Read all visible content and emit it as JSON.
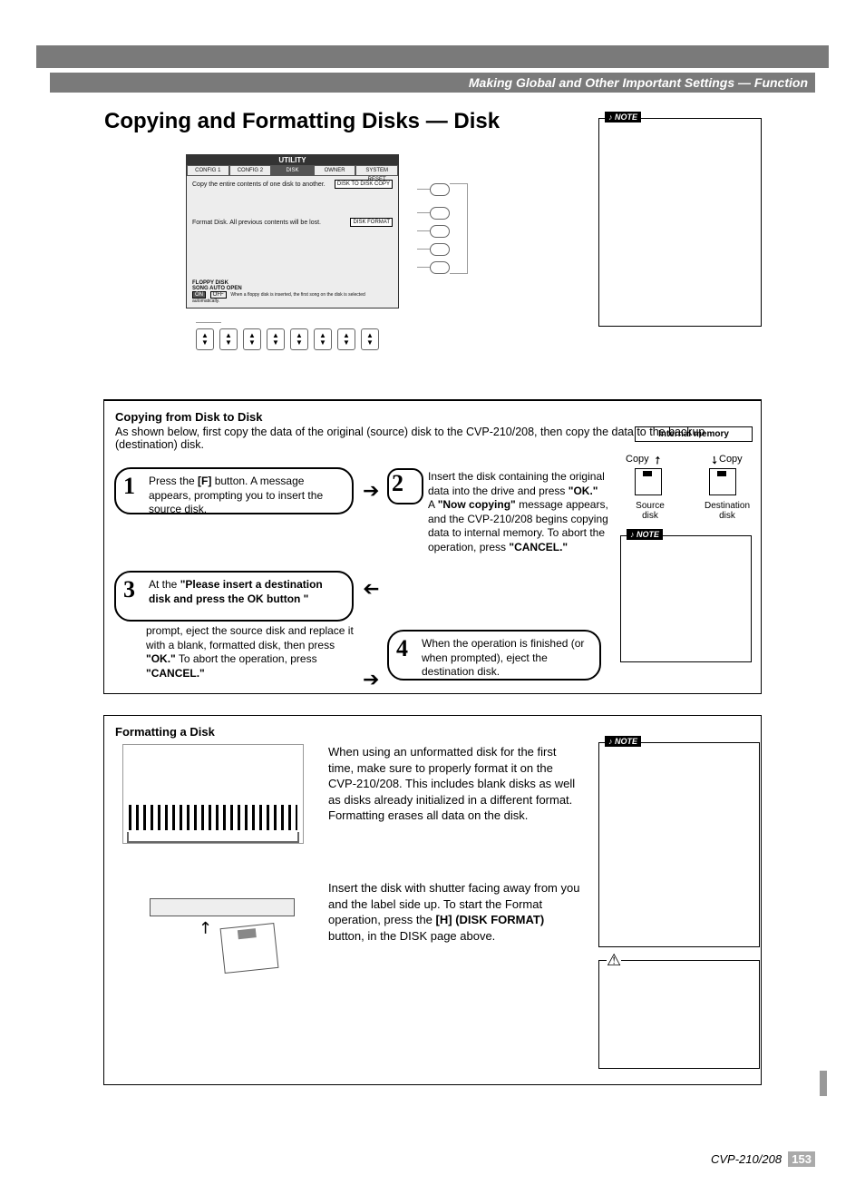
{
  "header": {
    "breadcrumb": "Making Global and Other Important Settings — Function"
  },
  "title": "Copying and Formatting Disks — Disk",
  "utility": {
    "title": "UTILITY",
    "tabs": [
      "CONFIG 1",
      "CONFIG 2",
      "DISK",
      "OWNER",
      "SYSTEM RESET"
    ],
    "row1_text": "Copy the entire contents of one disk to another.",
    "row1_btn": "DISK TO DISK COPY",
    "row2_text": "Format Disk. All previous contents will be lost.",
    "row2_btn": "DISK FORMAT",
    "bottom_title": "FLOPPY DISK\nSONG AUTO OPEN",
    "bottom_on": "ON",
    "bottom_off": "OFF",
    "bottom_desc": "When a floppy disk is inserted, the first song on the disk is selected automatically."
  },
  "instructions": {
    "heading": "Copying from Disk to Disk",
    "intro": "As shown below, first copy the data of the original (source) disk to the CVP-210/208, then copy the data to the backup (destination) disk.",
    "step1": "Press the [F] button. A message appears, prompting you to insert the source disk.",
    "step2": "Insert the disk containing the original data into the drive and press \"OK.\"\nA \"Now copying\" message appears, and the CVP-210/208 begins copying data to internal memory. To abort the operation, press \"CANCEL.\"",
    "step3": "At the \"Please insert a destination disk and press the OK button \" prompt, eject the source disk and replace it with a blank, formatted disk, then press \"OK.\" To abort the operation, press \"CANCEL.\"",
    "step3_leadin": "At the ",
    "step3_bold": "\"Please insert a destination disk and press the OK button \"",
    "step4": "When the operation is finished (or when prompted), eject the destination disk.",
    "intmem": "Internal memory",
    "copy": "Copy",
    "src": "Source disk",
    "dst": "Destination disk"
  },
  "format": {
    "heading": "Formatting a Disk",
    "para1": "When using an unformatted disk for the first time, make sure to properly format it on the CVP-210/208. This includes blank disks as well as disks already initialized in a different format. Formatting erases all data on the disk.",
    "para2": "Insert the disk with shutter facing away from you and the label side up. To start the Format operation, press the [H] (DISK FORMAT) button, in the DISK page above."
  },
  "footer": {
    "product": "CVP-210/208",
    "page": "153"
  }
}
